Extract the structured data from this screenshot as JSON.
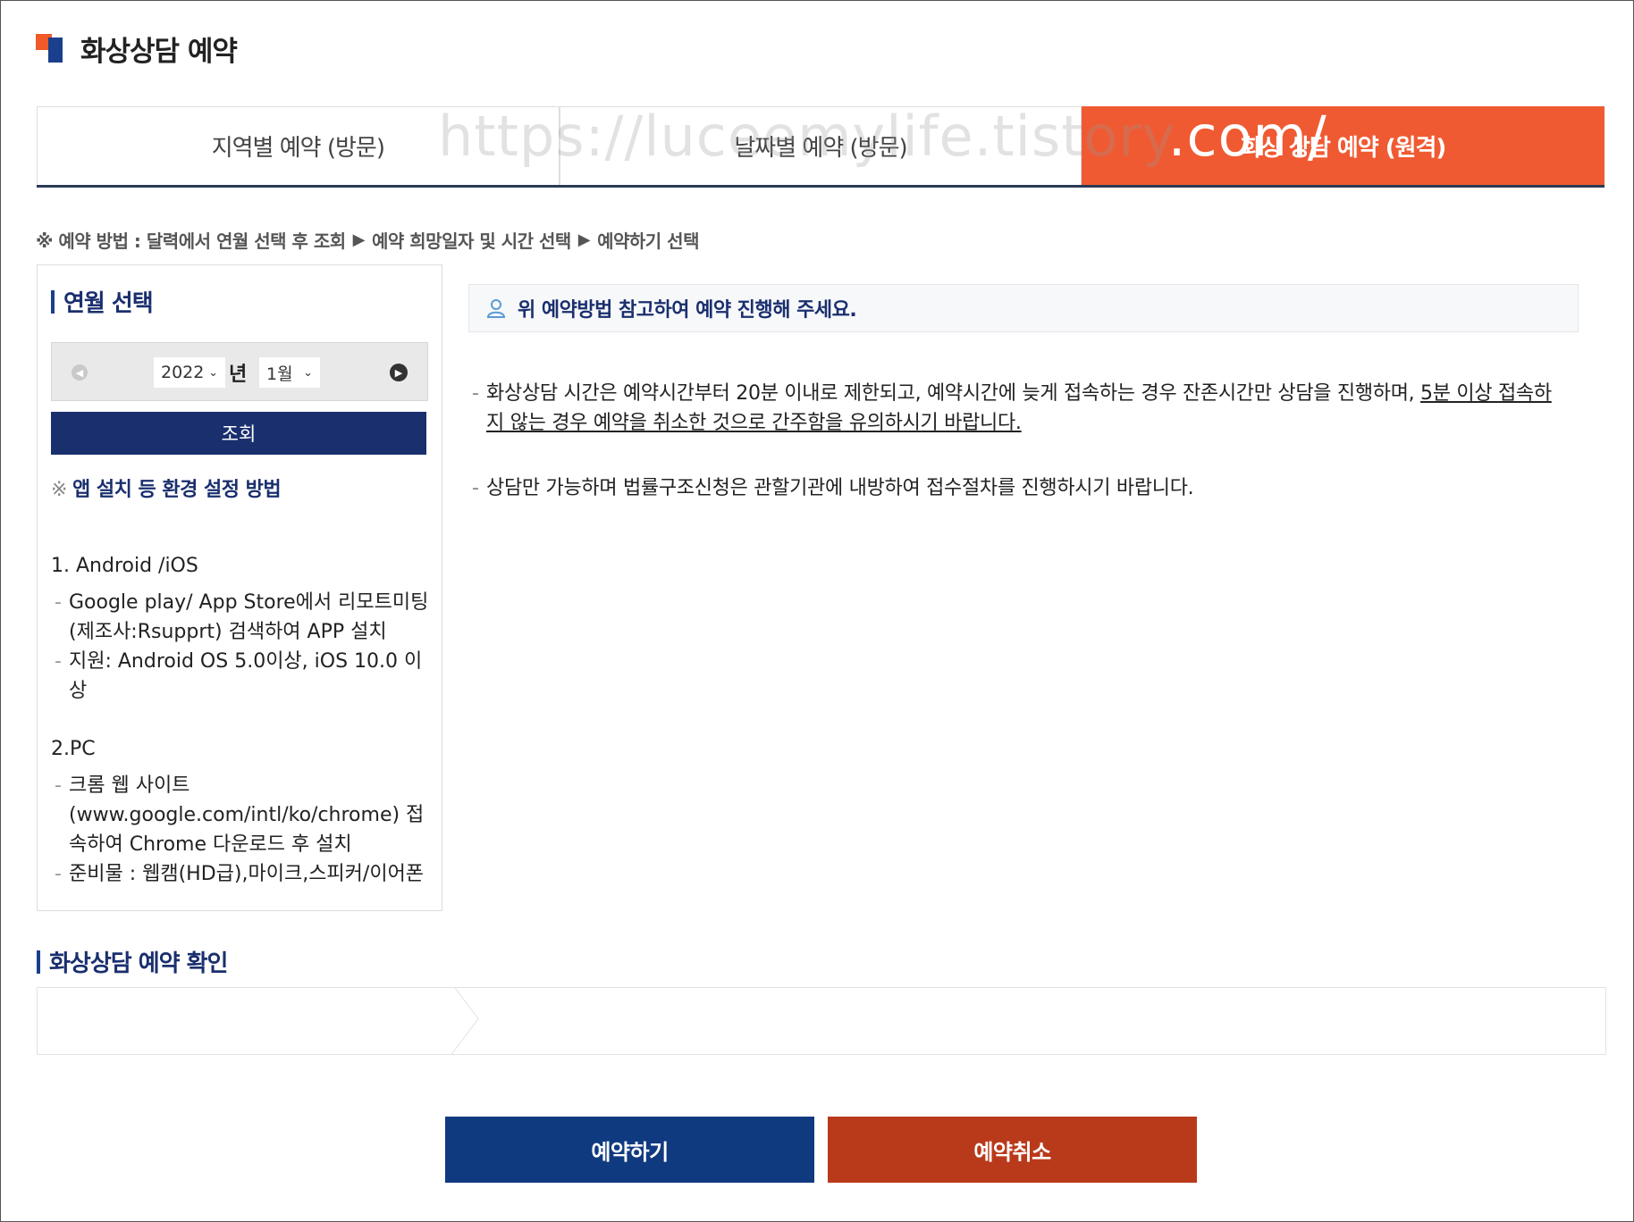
{
  "page": {
    "title": "화상상담 예약"
  },
  "tabs": [
    {
      "label": "지역별 예약 (방문)"
    },
    {
      "label": "날짜별 예약 (방문)"
    },
    {
      "label": "화상 상담 예약 (원격)"
    }
  ],
  "watermark": {
    "text": "https://luceemylife.tistory",
    "suffix": ".com/"
  },
  "method": {
    "prefix": "※ 예약 방법 : 달력에서 연월 선택 후 조회",
    "step2": "예약 희망일자 및 시간 선택",
    "step3": "예약하기 선택",
    "arrow": "▶"
  },
  "month_select": {
    "heading": "연월 선택",
    "year": "2022",
    "year_unit": "년",
    "month": "1월",
    "search_label": "조회",
    "env_mark": "※",
    "env_link": "앱 설치 등 환경 설정 방법"
  },
  "guide": {
    "mobile_heading": "1. Android /iOS",
    "mobile_items": [
      "Google play/ App Store에서 리모트미팅(제조사:Rsupprt) 검색하여 APP 설치",
      "지원: Android OS 5.0이상, iOS 10.0 이상"
    ],
    "pc_heading": "2.PC",
    "pc_items": [
      "크롬 웹 사이트 (www.google.com/intl/ko/chrome) 접속하여 Chrome 다운로드 후 설치",
      "준비물 : 웹캠(HD급),마이크,스피커/이어폰"
    ]
  },
  "notice": {
    "text": "위 예약방법 참고하여 예약 진행해 주세요."
  },
  "info": {
    "item1_plain": "화상상담 시간은 예약시간부터 20분 이내로 제한되고, 예약시간에 늦게 접속하는 경우 잔존시간만 상담을 진행하며, ",
    "item1_underline": "5분 이상 접속하지 않는 경우 예약을 취소한 것으로 간주함을 유의하시기 바랍니다.",
    "item2": "상담만 가능하며 법률구조신청은 관할기관에 내방하여 접수절차를 진행하시기 바랍니다."
  },
  "confirm": {
    "heading": "화상상담 예약 확인"
  },
  "buttons": {
    "reserve": "예약하기",
    "cancel": "예약취소"
  },
  "colors": {
    "accent": "#f05a32",
    "navy": "#1a2f6e",
    "reserve_bg": "#103a80",
    "cancel_bg": "#b93a1a"
  }
}
